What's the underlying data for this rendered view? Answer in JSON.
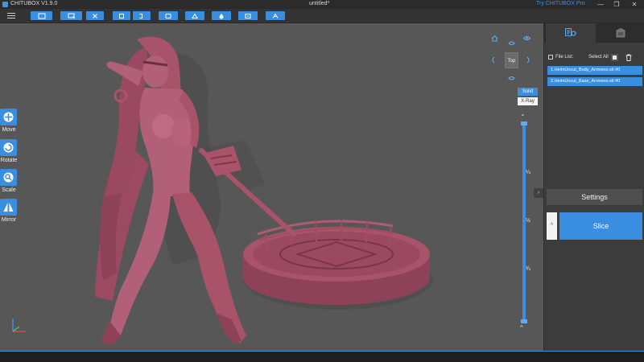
{
  "app": {
    "title": "CHITUBOX V1.9.0",
    "document_title": "untitled*",
    "pro_link": "Try CHITUBOX Pro"
  },
  "window_controls": {
    "minimize": "—",
    "maximize": "❐",
    "close": "✕"
  },
  "toolbar": {
    "buttons": [
      "open-file-icon",
      "save-file-icon",
      "fix-model-icon",
      "mirror-model-icon",
      "zoom-fit-icon",
      "hollow-icon",
      "dig-hole-icon",
      "layout-icon",
      "support-icon"
    ]
  },
  "left_tools": {
    "move": "Move",
    "rotate": "Rotate",
    "scale": "Scale",
    "mirror": "Mirror"
  },
  "view": {
    "top": "Top",
    "solid": "Solid",
    "xray": "X-Ray"
  },
  "slider": {
    "ticks": [
      "¼",
      "½",
      "¾"
    ],
    "up": "⌄",
    "down": "^"
  },
  "panel": {
    "file_list_label": "File List:",
    "select_all": "Select All",
    "files": [
      "1.HelmUncut_Body_Armrene.stl #0",
      "2.HelmUncut_Base_Armrene.stl #0"
    ],
    "settings": "Settings",
    "slice": "Slice",
    "slice_up": "^",
    "expand": "›"
  },
  "colors": {
    "accent": "#3a8ee0",
    "model": "#a8536a",
    "viewport": "#575757",
    "panel": "#3c3c3c"
  }
}
